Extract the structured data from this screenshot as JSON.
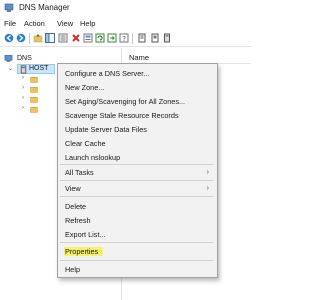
{
  "window": {
    "title": "DNS Manager"
  },
  "menubar": {
    "items": [
      "File",
      "Action",
      "View",
      "Help"
    ]
  },
  "toolbar": {
    "icons": [
      "back-arrow-icon",
      "forward-arrow-icon",
      "folder-up-icon",
      "console-tree-icon",
      "delete-x-icon",
      "properties-icon",
      "refresh-icon",
      "export-list-icon",
      "help-icon",
      "dns-record-icon",
      "zone-icon",
      "server-icon"
    ]
  },
  "tree": {
    "root_label": "DNS",
    "host_label": "HOST",
    "children": [
      "folder",
      "folder",
      "folder",
      "folder"
    ]
  },
  "list_pane": {
    "column_name": "Name"
  },
  "context_menu": {
    "items": [
      {
        "label": "Configure a DNS Server...",
        "submenu": false
      },
      {
        "label": "New Zone...",
        "submenu": false
      },
      {
        "label": "Set Aging/Scavenging for All Zones...",
        "submenu": false
      },
      {
        "label": "Scavenge Stale Resource Records",
        "submenu": false
      },
      {
        "label": "Update Server Data Files",
        "submenu": false
      },
      {
        "label": "Clear Cache",
        "submenu": false
      },
      {
        "label": "Launch nslookup",
        "submenu": false
      },
      {
        "label": "All Tasks",
        "submenu": true
      },
      {
        "label": "View",
        "submenu": true
      },
      {
        "label": "Delete",
        "submenu": false
      },
      {
        "label": "Refresh",
        "submenu": false
      },
      {
        "label": "Export List...",
        "submenu": false
      },
      {
        "label": "Properties",
        "submenu": false,
        "highlighted": true
      },
      {
        "label": "Help",
        "submenu": false
      }
    ],
    "highlight_color": "#f6f06a"
  },
  "colors": {
    "selection": "#cce4f7",
    "menu_bg": "#f2f2f2"
  }
}
